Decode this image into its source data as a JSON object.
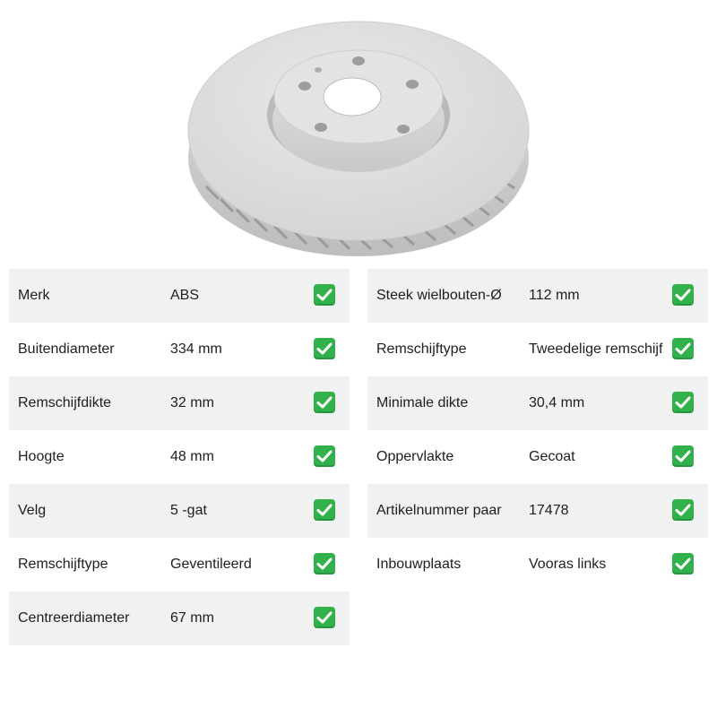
{
  "specs_left": [
    {
      "label": "Merk",
      "value": "ABS"
    },
    {
      "label": "Buitendiameter",
      "value": "334 mm"
    },
    {
      "label": "Remschijfdikte",
      "value": "32 mm"
    },
    {
      "label": "Hoogte",
      "value": "48 mm"
    },
    {
      "label": "Velg",
      "value": "5 -gat"
    },
    {
      "label": "Remschijftype",
      "value": "Geventileerd"
    },
    {
      "label": "Centreerdiameter",
      "value": "67 mm"
    }
  ],
  "specs_right": [
    {
      "label": "Steek wielbouten-Ø",
      "value": "112 mm"
    },
    {
      "label": "Remschijftype",
      "value": "Tweedelige remschijf"
    },
    {
      "label": "Minimale dikte",
      "value": "30,4 mm"
    },
    {
      "label": "Oppervlakte",
      "value": "Gecoat"
    },
    {
      "label": "Artikelnummer paar",
      "value": "17478"
    },
    {
      "label": "Inbouwplaats",
      "value": "Vooras links"
    }
  ],
  "icons": {
    "check": "check-mark-icon",
    "check_color": "#31b04c"
  }
}
